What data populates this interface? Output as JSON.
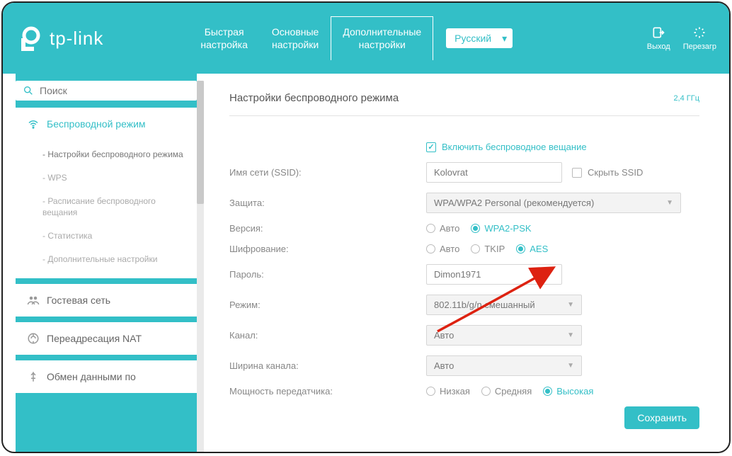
{
  "header": {
    "brand": "tp-link",
    "tabs": [
      {
        "line1": "Быстрая",
        "line2": "настройка"
      },
      {
        "line1": "Основные",
        "line2": "настройки"
      },
      {
        "line1": "Дополнительные",
        "line2": "настройки"
      }
    ],
    "language": "Русский",
    "actions": {
      "logout": "Выход",
      "reboot": "Перезагр"
    }
  },
  "sidebar": {
    "search_placeholder": "Поиск",
    "items": [
      {
        "label": "Беспроводной режим",
        "children": [
          "- Настройки беспроводного режима",
          "- WPS",
          "- Расписание беспроводного вещания",
          "- Статистика",
          "- Дополнительные настройки"
        ]
      },
      {
        "label": "Гостевая сеть"
      },
      {
        "label": "Переадресация NAT"
      },
      {
        "label": "Обмен данными по"
      }
    ]
  },
  "main": {
    "title": "Настройки беспроводного режима",
    "band": "2,4 ГГц",
    "enable_wireless": "Включить беспроводное вещание",
    "fields": {
      "ssid": {
        "label": "Имя сети (SSID):",
        "value": "Kolovrat",
        "hide_label": "Скрыть SSID"
      },
      "security": {
        "label": "Защита:",
        "value": "WPA/WPA2 Personal (рекомендуется)"
      },
      "version": {
        "label": "Версия:",
        "options": [
          "Авто",
          "WPA2-PSK"
        ],
        "selected": "WPA2-PSK"
      },
      "encryption": {
        "label": "Шифрование:",
        "options": [
          "Авто",
          "TKIP",
          "AES"
        ],
        "selected": "AES"
      },
      "password": {
        "label": "Пароль:",
        "value": "Dimon1971"
      },
      "mode": {
        "label": "Режим:",
        "value": "802.11b/g/n смешанный"
      },
      "channel": {
        "label": "Канал:",
        "value": "Авто"
      },
      "channel_width": {
        "label": "Ширина канала:",
        "value": "Авто"
      },
      "tx_power": {
        "label": "Мощность передатчика:",
        "options": [
          "Низкая",
          "Средняя",
          "Высокая"
        ],
        "selected": "Высокая"
      }
    },
    "save_label": "Сохранить"
  },
  "colors": {
    "accent": "#33bfc7",
    "annotation": "#d21"
  }
}
